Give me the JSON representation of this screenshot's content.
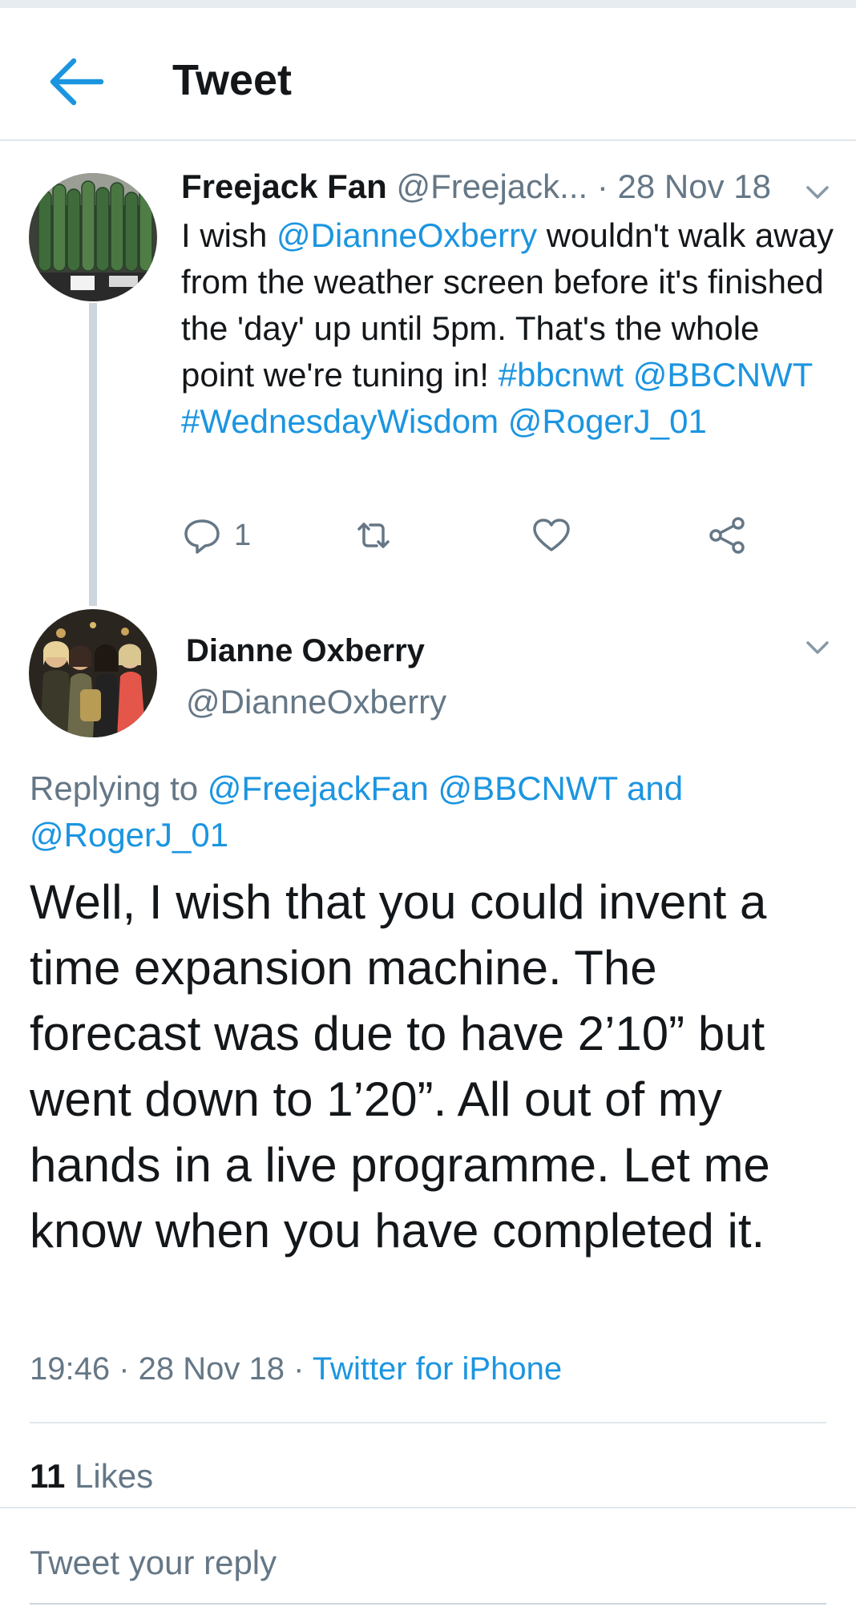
{
  "colors": {
    "accent": "#1b95e0",
    "text": "#14171a",
    "muted": "#657786",
    "divider": "#e1e8ed"
  },
  "header": {
    "title": "Tweet",
    "back_icon": "arrow-left-icon"
  },
  "tweet1": {
    "author_name": "Freejack Fan",
    "author_handle": "@Freejack...",
    "separator": "·",
    "date": "28 Nov 18",
    "text_1": "I wish ",
    "mention_1": "@DianneOxberry",
    "text_2": " wouldn't walk away from the weather screen before it's finished the 'day' up until 5pm. That's the whole point we're tuning in! ",
    "hashtag_1": "#bbcnwt",
    "mention_2": "@BBCNWT",
    "hashtag_2": "#WednesdayWisdom",
    "mention_3": "@RogerJ_01",
    "reply_count": "1",
    "action_icons": [
      "reply-icon",
      "retweet-icon",
      "like-icon",
      "share-icon"
    ]
  },
  "tweet2": {
    "author_name": "Dianne Oxberry",
    "author_handle": "@DianneOxberry",
    "replying_prefix": "Replying to ",
    "reply_mention_1": "@FreejackFan",
    "reply_mention_2": "@BBCNWT",
    "reply_and": "and",
    "reply_mention_3": "@RogerJ_01",
    "text": "Well, I wish that you could invent a time expansion machine.  The forecast was due to have 2’10” but went down to 1’20”.  All out of my hands in a live programme. Let me know when you have completed it.",
    "time": "19:46",
    "separator": " · ",
    "date": "28 Nov 18",
    "source": "Twitter for iPhone",
    "likes_count": "11",
    "likes_label": "Likes"
  },
  "reply_box": {
    "placeholder": "Tweet your reply"
  }
}
